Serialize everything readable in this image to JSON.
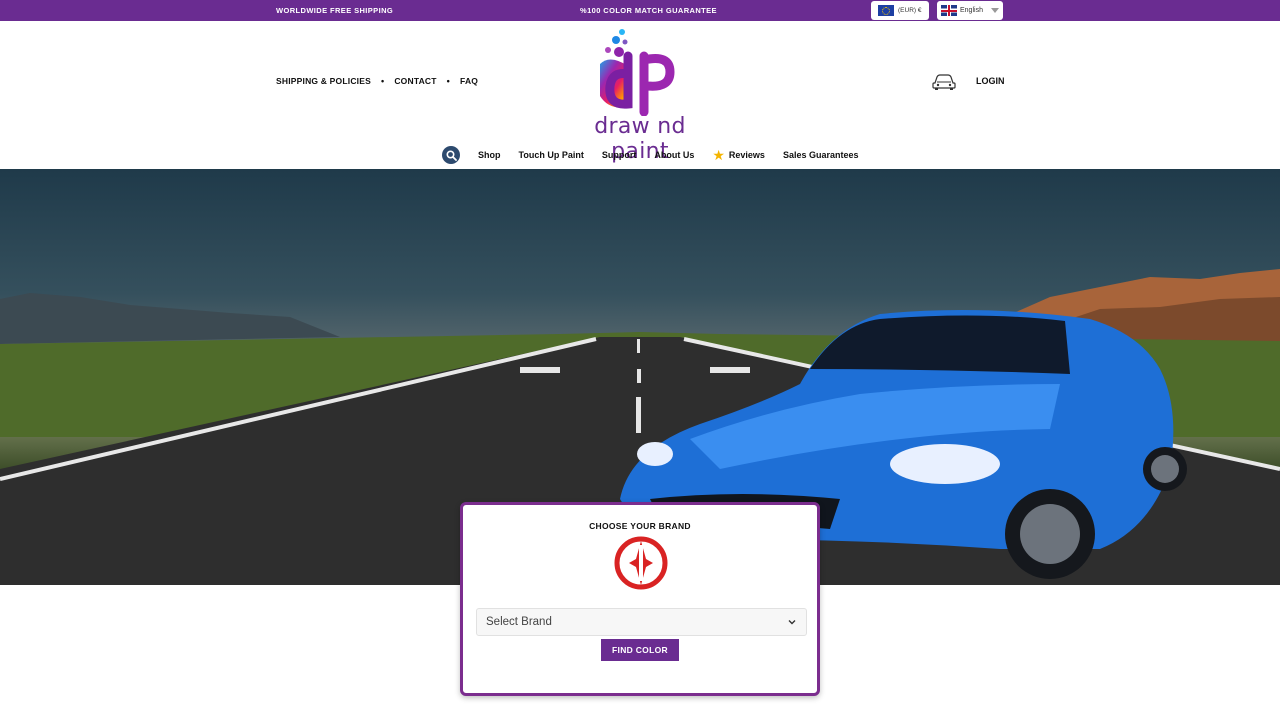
{
  "topbar": {
    "free_shipping": "WORLDWIDE FREE SHIPPING",
    "guarantee": "%100 COLOR MATCH GUARANTEE",
    "currency": "(EUR) €",
    "language": "English"
  },
  "header": {
    "nav_left": [
      "SHIPPING & POLICIES",
      "CONTACT",
      "FAQ"
    ],
    "logo_text": "draw nd paint",
    "login": "LOGIN",
    "icons": {
      "garage": "car-icon",
      "search": "search-icon",
      "reviews": "star-icon"
    }
  },
  "subnav": {
    "items": [
      "Shop",
      "Touch Up Paint",
      "Support",
      "About Us",
      "Reviews",
      "Sales Guarantees"
    ]
  },
  "brand_selector": {
    "title": "CHOOSE YOUR BRAND",
    "select_placeholder": "Select Brand",
    "button": "FIND COLOR"
  },
  "colors": {
    "brand_purple": "#6a2c91",
    "accent_border": "#7b2d8e",
    "search_button": "#2d4a6e",
    "brand_logo_red": "#d92323"
  }
}
